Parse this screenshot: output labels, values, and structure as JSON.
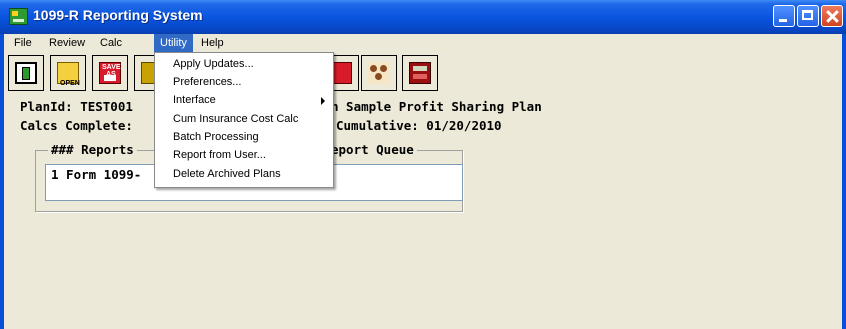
{
  "window": {
    "title": "1099-R Reporting System"
  },
  "menubar": {
    "items": [
      {
        "label": "File"
      },
      {
        "label": "Review"
      },
      {
        "label": "Calc"
      },
      {
        "label": "Utility"
      },
      {
        "label": "Help"
      }
    ],
    "active": "Utility"
  },
  "toolbar": {
    "open_caption": "OPEN",
    "save_caption_top": "SAVE",
    "save_caption_bottom": "AS",
    "buttons": [
      "exit-icon",
      "open-folder-icon",
      "save-as-disk-icon",
      "print-icon",
      "red-book-icon",
      "people-icon",
      "calculator-icon"
    ]
  },
  "info": {
    "plan_id_text": "PlanId: TEST001",
    "plan_name_text": "n Sample Profit Sharing Plan",
    "calcs_complete_text": "Calcs Complete:",
    "cumulative_text": "Cumulative: 01/20/2010"
  },
  "reports": {
    "group_label_left": "### Reports",
    "group_label_right": "eport Queue",
    "rows": [
      "1 Form 1099-"
    ]
  },
  "utility_menu": {
    "items": [
      {
        "label": "Apply Updates..."
      },
      {
        "label": "Preferences..."
      },
      {
        "label": "Interface",
        "has_submenu": true
      },
      {
        "label": "Cum Insurance Cost Calc"
      },
      {
        "label": "Batch Processing"
      },
      {
        "label": "Report from User..."
      },
      {
        "label": "Delete Archived Plans"
      }
    ]
  },
  "colors": {
    "title_bar": "#0a55e0",
    "client_bg": "#ece9d8",
    "menu_highlight": "#316ac5",
    "close_button": "#d0431f"
  }
}
